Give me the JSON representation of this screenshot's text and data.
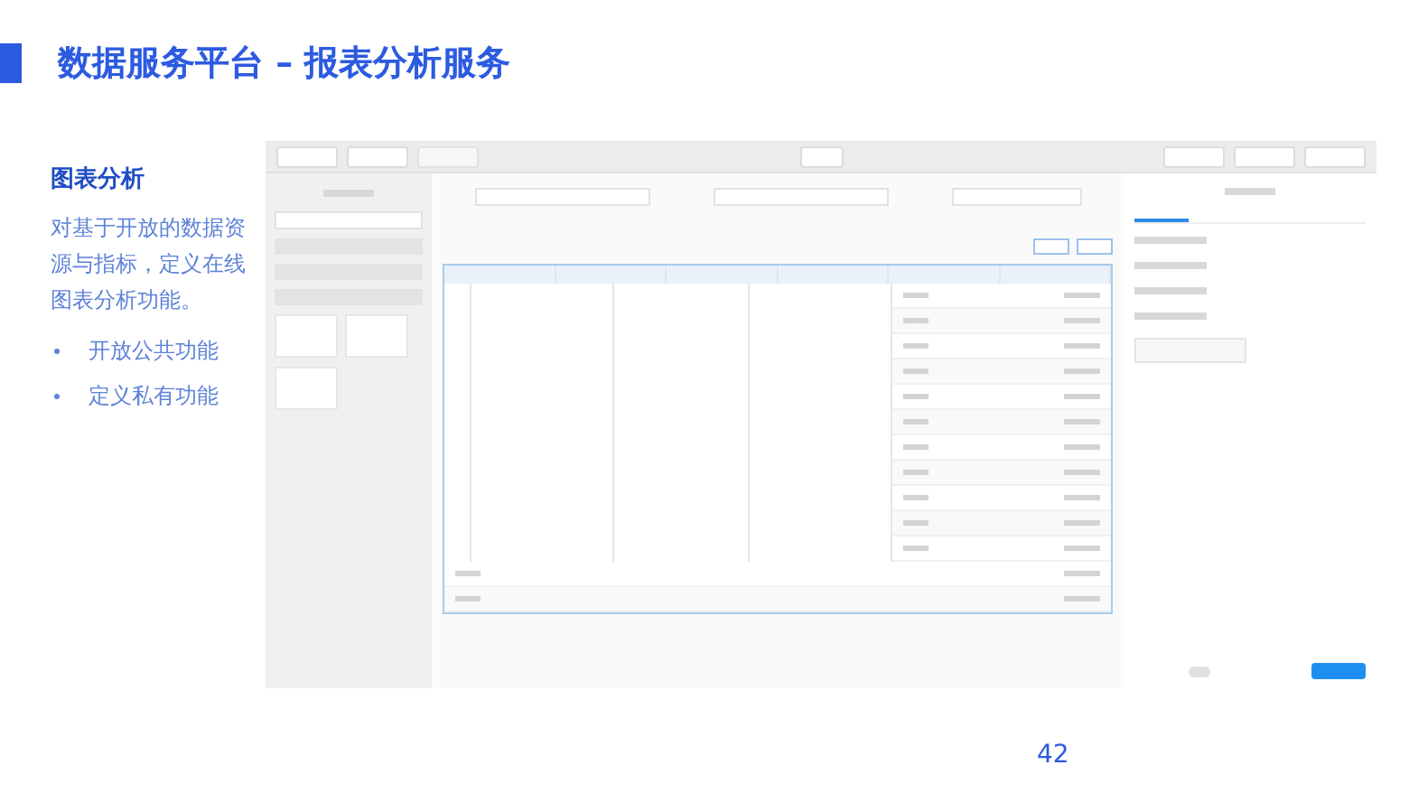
{
  "slide_title": "数据服务平台 – 报表分析服务",
  "section": {
    "heading": "图表分析",
    "description": "对基于开放的数据资源与指标，定义在线图表分析功能。",
    "bullets": [
      "开放公共功能",
      "定义私有功能"
    ]
  },
  "page_number": "42"
}
